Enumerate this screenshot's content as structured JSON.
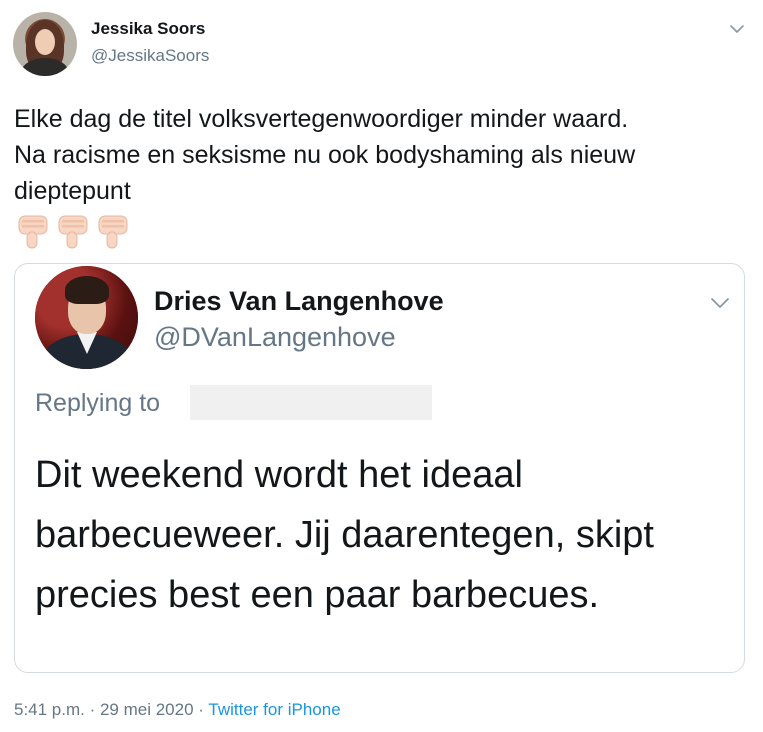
{
  "tweet": {
    "author_name": "Jessika Soors",
    "author_handle": "@JessikaSoors",
    "text_lines": [
      "Elke dag de titel volksvertegenwoordiger minder waard.",
      "Na racisme en seksisme nu ook bodyshaming als nieuw",
      "dieptepunt"
    ],
    "emoji": [
      "thumbs-down-icon",
      "thumbs-down-icon",
      "thumbs-down-icon"
    ],
    "timestamp": "5:41 p.m. · 29 mei 2020",
    "separator": "·",
    "source": "Twitter for iPhone"
  },
  "quoted": {
    "author_name": "Dries Van Langenhove",
    "author_handle": "@DVanLangenhove",
    "replying_to_label": "Replying to",
    "text_lines": [
      "Dit weekend wordt het ideaal",
      "barbecueweer. Jij daarentegen, skipt",
      "precies best een paar barbecues."
    ]
  },
  "colors": {
    "text_primary": "#14171a",
    "text_secondary": "#657786",
    "link": "#1b95e0",
    "border": "#d6dbdf",
    "emoji_skin": "#f7d6c4"
  }
}
